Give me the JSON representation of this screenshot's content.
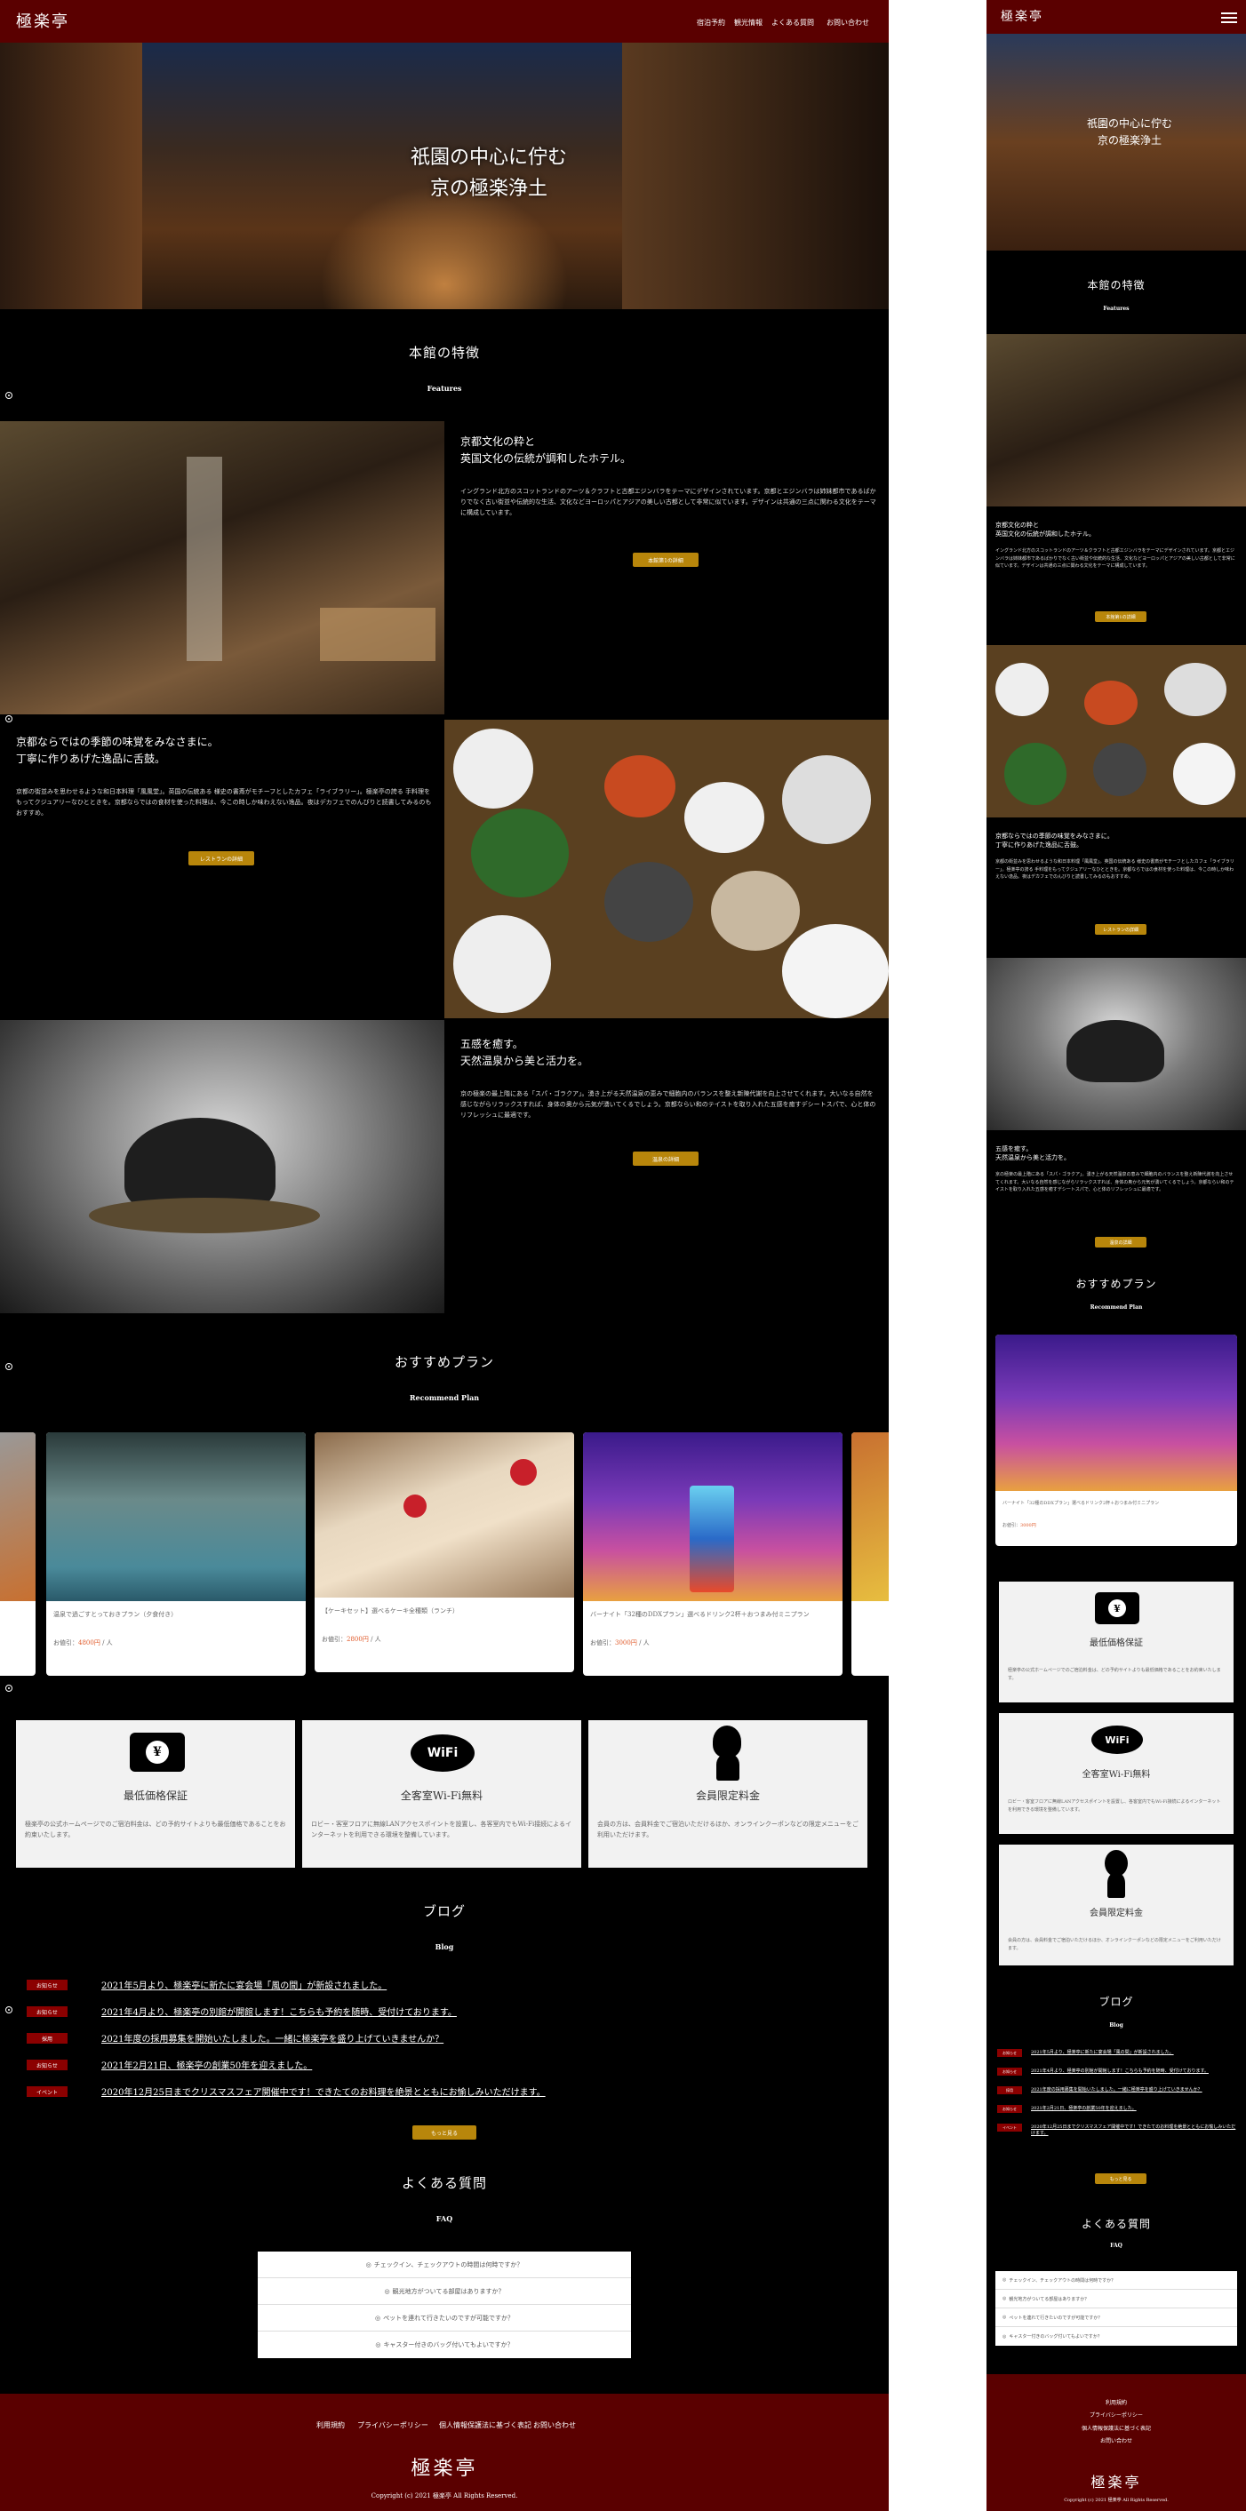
{
  "brand": "極楽亭",
  "nav": [
    "宿泊予約",
    "観光情報",
    "よくある質問",
    "お問い合わせ"
  ],
  "hero": {
    "line1": "祇園の中心に佇む",
    "line2": "京の極楽浄土"
  },
  "features": {
    "title": "本館の特徴",
    "subtitle": "Features",
    "items": [
      {
        "h1": "京都文化の粋と",
        "h2": "英国文化の伝統が調和したホテル。",
        "body": "イングランド北方のスコットランドのアーツ＆クラフトと古都エジンバラをテーマにデザインされています。京都とエジンバラは姉妹都市であるばかりでなく古い街並や伝統的な生活、文化などヨーロッパとアジアの美しい古都として非常に似ています。デザインは共通の三点に関わる文化をテーマに構成しています。",
        "button": "本館第1の詳細"
      },
      {
        "h1": "京都ならではの季節の味覚をみなさまに。",
        "h2": "丁寧に作りあげた逸品に舌鼓。",
        "body": "京都の街並みを思わせるような和日本料理「風風堂」。英国の伝統ある 様史の書斎がモチーフとしたカフェ「ライブラリー」。極楽亭の誇る 手料理をもってクジュアリーなひとときを。京都ならではの食材を使った料理は、今この時しか味わえない逸品。夜はデカフェでのんびりと読書してみるのもおすすめ。",
        "button": "レストランの詳細"
      },
      {
        "h1": "五感を癒す。",
        "h2": "天然温泉から美と活力を。",
        "body": "京の極楽の最上階にある「スパ・ゴラクア」。湧き上がる天然温泉の恵みで細胞内のバランスを整え新陳代謝を向上させてくれます。大いなる自然を感じながらリラックスすれば、身体の奥から元気が湧いてくるでしょう。京都ならい和のテイストを取り入れた五感を癒すデシートスパで、心と体のリフレッシュに最適です。",
        "button": "温泉の詳細"
      }
    ]
  },
  "plans": {
    "title": "おすすめプラン",
    "subtitle": "Recommend Plan",
    "price_label": "お値引：",
    "price_unit": "/ 人",
    "items": [
      {
        "name": "温泉で過ごすとっておきプラン（夕食付き）",
        "price": "4800円"
      },
      {
        "name": "【ケーキセット】選べるケーキ全種類（ランチ）",
        "price": "2800円"
      },
      {
        "name": "バーナイト「32種のDDXプラン」選べるドリンク2杯＋おつまみ付ミニプラン",
        "price": "3000円"
      }
    ]
  },
  "benefits": [
    {
      "title": "最低価格保証",
      "desc": "極楽亭の公式ホームページでのご宿泊料金は、どの予約サイトよりも最低価格であることをお約束いたします。"
    },
    {
      "title": "全客室Wi-Fi無料",
      "desc": "ロビー・客室フロアに無線LANアクセスポイントを設置し、各客室内でもWi-Fi接続によるインターネットを利用できる環境を整備しています。"
    },
    {
      "title": "会員限定料金",
      "desc": "会員の方は、会員料金でご宿泊いただけるほか、オンラインクーポンなどの限定メニューをご利用いただけます。"
    }
  ],
  "blog": {
    "title": "ブログ",
    "subtitle": "Blog",
    "items": [
      {
        "tag": "お知らせ",
        "text": "2021年5月より、極楽亭に新たに宴会場「風の間」が新設されました。"
      },
      {
        "tag": "お知らせ",
        "text": "2021年4月より、極楽亭の別館が開館します！こちらも予約を随時、受付けております。"
      },
      {
        "tag": "採用",
        "text": "2021年度の採用募集を開始いたしました。一緒に極楽亭を盛り上げていきませんか？"
      },
      {
        "tag": "お知らせ",
        "text": "2021年2月21日、極楽亭の創業50年を迎えました。"
      },
      {
        "tag": "イベント",
        "text": "2020年12月25日までクリスマスフェア開催中です！できたてのお料理を絶景とともにお愉しみいただけます。"
      }
    ],
    "more": "もっと見る"
  },
  "faq": {
    "title": "よくある質問",
    "subtitle": "FAQ",
    "items": [
      "チェックイン、チェックアウトの時間は何時ですか？",
      "観光地方がついてる部屋はありますか？",
      "ペットを連れて行きたいのですが可能ですか？",
      "キャスター付きのバッグ付いてもよいですか？"
    ]
  },
  "footer": {
    "links": [
      "利用規約",
      "プライバシーポリシー",
      "個人情報保護法に基づく表記",
      "お問い合わせ"
    ],
    "copyright": "Copyright (c) 2021 極楽亭 All Rights Reserved."
  },
  "colors": {
    "maroon": "#5a0000",
    "gold": "#b8860b",
    "tag_red": "#8b0000"
  }
}
